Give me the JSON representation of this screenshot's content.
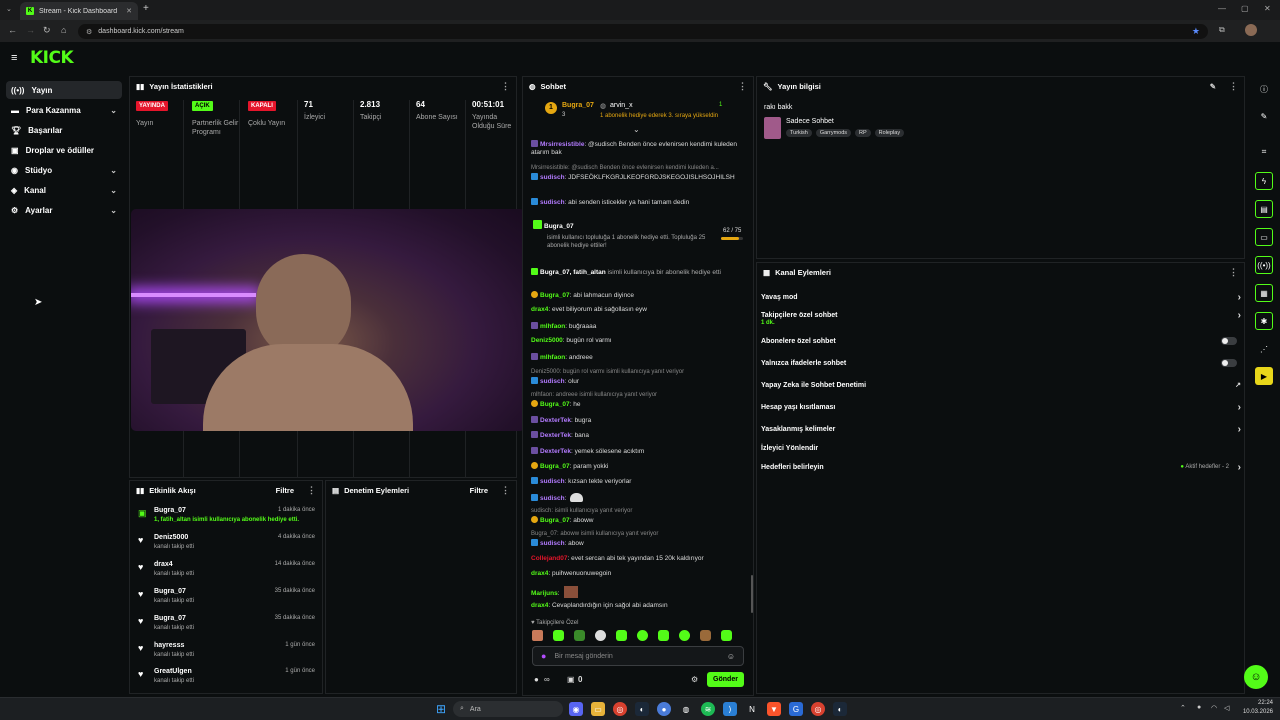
{
  "browser": {
    "tab_title": "Stream - Kick Dashboard",
    "url": "dashboard.kick.com/stream",
    "new_tab": "+"
  },
  "brand": {
    "logo": "KICK",
    "accent": "#53fc18"
  },
  "sidebar": {
    "items": [
      {
        "label": "Yayın",
        "icon": "broadcast-icon"
      },
      {
        "label": "Para Kazanma",
        "icon": "money-icon"
      },
      {
        "label": "Başarılar",
        "icon": "trophy-icon"
      },
      {
        "label": "Droplar ve ödüller",
        "icon": "gift-icon"
      },
      {
        "label": "Stüdyo",
        "icon": "studio-icon"
      },
      {
        "label": "Kanal",
        "icon": "channel-icon"
      },
      {
        "label": "Ayarlar",
        "icon": "gear-icon"
      }
    ]
  },
  "stats": {
    "title": "Yayın İstatistikleri",
    "cols": [
      {
        "badge": "YAYINDA",
        "badge_color": "#e5152b",
        "label": "Yayın"
      },
      {
        "badge": "AÇIK",
        "badge_color": "#53fc18",
        "label": "Partnerlik Gelir Programı"
      },
      {
        "badge": "KAPALI",
        "badge_color": "#e5152b",
        "label": "Çoklu Yayın"
      },
      {
        "value": "71",
        "label": "İzleyici"
      },
      {
        "value": "2.813",
        "label": "Takipçi"
      },
      {
        "value": "64",
        "label": "Abone Sayısı"
      },
      {
        "value": "00:51:01",
        "label": "Yayında Olduğu Süre"
      }
    ]
  },
  "events": {
    "title": "Etkinlik Akışı",
    "filter": "Filtre",
    "items": [
      {
        "name": "Bugra_07",
        "sub": "1, fatih_altan isimli kullanıcıya abonelik hediye etti.",
        "time": "1 dakika önce",
        "icon": "gift-icon"
      },
      {
        "name": "Deniz5000",
        "sub": "kanalı takip etti",
        "time": "4 dakika önce",
        "icon": "heart-icon"
      },
      {
        "name": "drax4",
        "sub": "kanalı takip etti",
        "time": "14 dakika önce",
        "icon": "heart-icon"
      },
      {
        "name": "Bugra_07",
        "sub": "kanalı takip etti",
        "time": "35 dakika önce",
        "icon": "heart-icon"
      },
      {
        "name": "Bugra_07",
        "sub": "kanalı takip etti",
        "time": "35 dakika önce",
        "icon": "heart-icon"
      },
      {
        "name": "hayresss",
        "sub": "kanalı takip etti",
        "time": "1 gün önce",
        "icon": "heart-icon"
      },
      {
        "name": "GreatUlgen",
        "sub": "kanalı takip etti",
        "time": "1 gün önce",
        "icon": "heart-icon"
      }
    ]
  },
  "moderation": {
    "title": "Denetim Eylemleri",
    "filter": "Filtre"
  },
  "chat": {
    "title": "Sohbet",
    "pinned": {
      "user1": "Bugra_07",
      "user2": "arvin_x",
      "count1": "3",
      "count2": "1",
      "note": "1 abonelik hediye ederek 3. sıraya yükseldin"
    },
    "messages": [
      {
        "user": "Mrsirresistible",
        "color": "#b37bff",
        "text": ": @sudisch Benden önce evlenirsen kendimi kuleden atarım bak"
      },
      {
        "reply": "Mrsirresistible: @sudisch Benden önce evlenirsen kendimi kuleden a..."
      },
      {
        "user": "sudisch",
        "color": "#b37bff",
        "text": ": JDFSEÖKLFKGRJLKEOFGRDJSKEGOJISLHSOJHILSH"
      },
      {
        "user": "sudisch",
        "color": "#b37bff",
        "text": ": abi senden isticekler ya hani tamam dedin"
      },
      {
        "user": "Bugra_07",
        "color": "#ffffff",
        "text": "isimli kullanıcı topluluğa 1 abonelik hediye etti. Topluluğa 25 abonelik hediye ettiler!",
        "progress": "62 / 75"
      },
      {
        "user": "Bugra_07, fatih_altan",
        "color": "#ffffff",
        "text": " isimli kullanıcıya bir abonelik hediye etti"
      },
      {
        "user": "Bugra_07",
        "color": "#53fc18",
        "text": ": abi lahmacun diyince"
      },
      {
        "user": "drax4",
        "color": "#53fc18",
        "text": ": evet biliyorum abi sağollasın eyw"
      },
      {
        "user": "mlhfaon",
        "color": "#53fc18",
        "text": ": buğraaaa"
      },
      {
        "user": "Deniz5000",
        "color": "#53fc18",
        "text": ": bugün rol varmı"
      },
      {
        "user": "mlhfaon",
        "color": "#53fc18",
        "text": ": andreee"
      },
      {
        "reply": "Deniz5000: bugün rol varmı isimli kullanıcıya yanıt veriyor"
      },
      {
        "user": "sudisch",
        "color": "#b37bff",
        "text": ": olur"
      },
      {
        "reply": "mlhfaon: andreee isimli kullanıcıya yanıt veriyor"
      },
      {
        "user": "Bugra_07",
        "color": "#53fc18",
        "text": ": he"
      },
      {
        "user": "DexterTek",
        "color": "#b37bff",
        "text": ": bugra"
      },
      {
        "user": "DexterTek",
        "color": "#b37bff",
        "text": ": bana"
      },
      {
        "user": "DexterTek",
        "color": "#b37bff",
        "text": ": yemek sölesene acıktım"
      },
      {
        "user": "Bugra_07",
        "color": "#53fc18",
        "text": ": param yokki"
      },
      {
        "user": "sudisch",
        "color": "#b37bff",
        "text": ": kızsan tekte veriyorlar"
      },
      {
        "user": "sudisch",
        "color": "#b37bff",
        "text": ":"
      },
      {
        "reply": "sudisch: isimli kullanıcıya yanıt veriyor"
      },
      {
        "user": "Bugra_07",
        "color": "#53fc18",
        "text": ": aboww"
      },
      {
        "reply": "Bugra_07: aboww isimli kullanıcıya yanıt veriyor"
      },
      {
        "user": "sudisch",
        "color": "#b37bff",
        "text": ": abow"
      },
      {
        "user": "Collejand07",
        "color": "#e5152b",
        "text": ": evet sercan abi tek yayından 15 20k kaldırıyor"
      },
      {
        "user": "drax4",
        "color": "#53fc18",
        "text": ": puihwenuonuwegoin"
      },
      {
        "user": "Marijuns",
        "color": "#53fc18",
        "text": ":"
      },
      {
        "user": "drax4",
        "color": "#53fc18",
        "text": ": Cevaplandırdığın için sağol abi adamsın"
      }
    ],
    "followers_only": "Takipçilere Özel",
    "input_placeholder": "Bir mesaj gönderin",
    "send": "Gönder",
    "viewers": "∞",
    "count": "0"
  },
  "stream_info": {
    "title": "Yayın bilgisi",
    "stream_title": "rakı bakk",
    "category": "Sadece Sohbet",
    "tags": [
      "Turkish",
      "Garrymods",
      "RP",
      "Roleplay"
    ]
  },
  "channel_actions": {
    "title": "Kanal Eylemleri",
    "rows": [
      {
        "label": "Yavaş mod",
        "type": "arrow"
      },
      {
        "label": "Takipçilere özel sohbet",
        "sub": "1 dk.",
        "type": "arrow"
      },
      {
        "label": "Abonelere özel sohbet",
        "type": "toggle"
      },
      {
        "label": "Yalnızca ifadelerle sohbet",
        "type": "toggle"
      },
      {
        "label": "Yapay Zeka ile Sohbet Denetimi",
        "type": "external"
      },
      {
        "label": "Hesap yaşı kısıtlaması",
        "type": "arrow"
      },
      {
        "label": "Yasaklanmış kelimeler",
        "type": "arrow"
      },
      {
        "label": "İzleyici Yönlendir",
        "type": "none"
      },
      {
        "label": "Hedefleri belirleyin",
        "type": "arrow",
        "extra": "Aktif hedefler - 2"
      }
    ]
  },
  "taskbar": {
    "search": "Ara",
    "time": "22:24",
    "date": "10.03.2026"
  }
}
